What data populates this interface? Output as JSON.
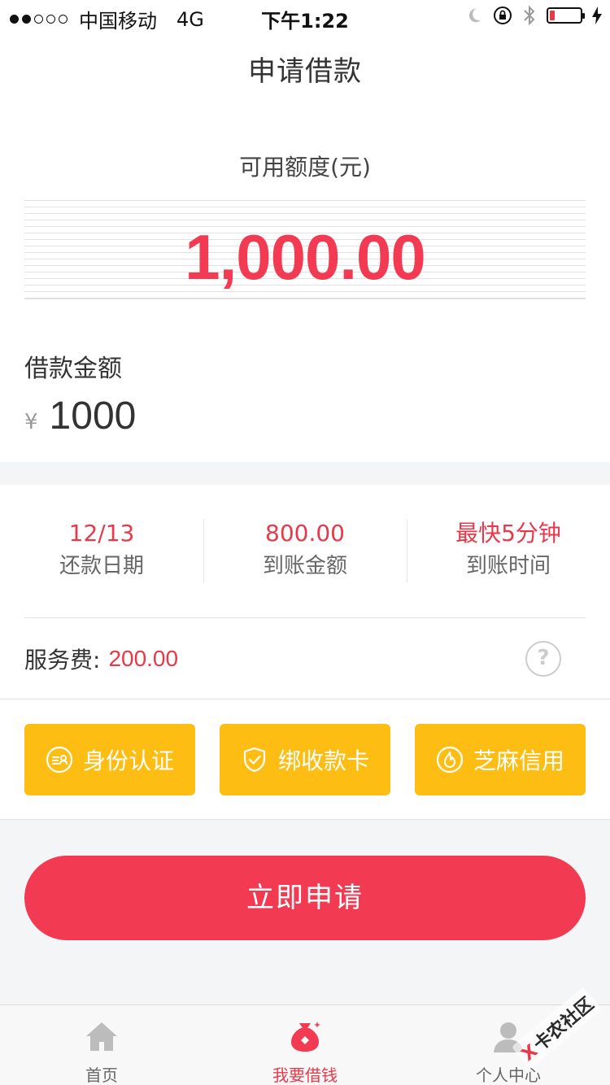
{
  "status_bar": {
    "carrier": "中国移动",
    "network": "4G",
    "time": "下午1:22"
  },
  "nav": {
    "title": "申请借款"
  },
  "quota": {
    "label": "可用额度(元)",
    "value": "1,000.00"
  },
  "loan": {
    "label": "借款金额",
    "currency": "¥",
    "amount": "1000"
  },
  "info": [
    {
      "value": "12/13",
      "label": "还款日期"
    },
    {
      "value": "800.00",
      "label": "到账金额"
    },
    {
      "value": "最快5分钟",
      "label": "到账时间"
    }
  ],
  "fee": {
    "label": "服务费:",
    "value": "200.00",
    "help_icon": "?"
  },
  "certs": [
    {
      "label": "身份认证",
      "icon": "id-card-icon"
    },
    {
      "label": "绑收款卡",
      "icon": "shield-check-icon"
    },
    {
      "label": "芝麻信用",
      "icon": "flame-icon"
    }
  ],
  "apply_button": "立即申请",
  "tabs": [
    {
      "label": "首页",
      "icon": "home-icon",
      "active": false
    },
    {
      "label": "我要借钱",
      "icon": "money-bag-icon",
      "active": true
    },
    {
      "label": "个人中心",
      "icon": "person-icon",
      "active": false
    }
  ],
  "watermark": {
    "mark": "X",
    "text": "卡农社区"
  },
  "colors": {
    "accent_red": "#f23a52",
    "button_yellow": "#fdbd12",
    "inactive_gray": "#bcbcbc"
  }
}
